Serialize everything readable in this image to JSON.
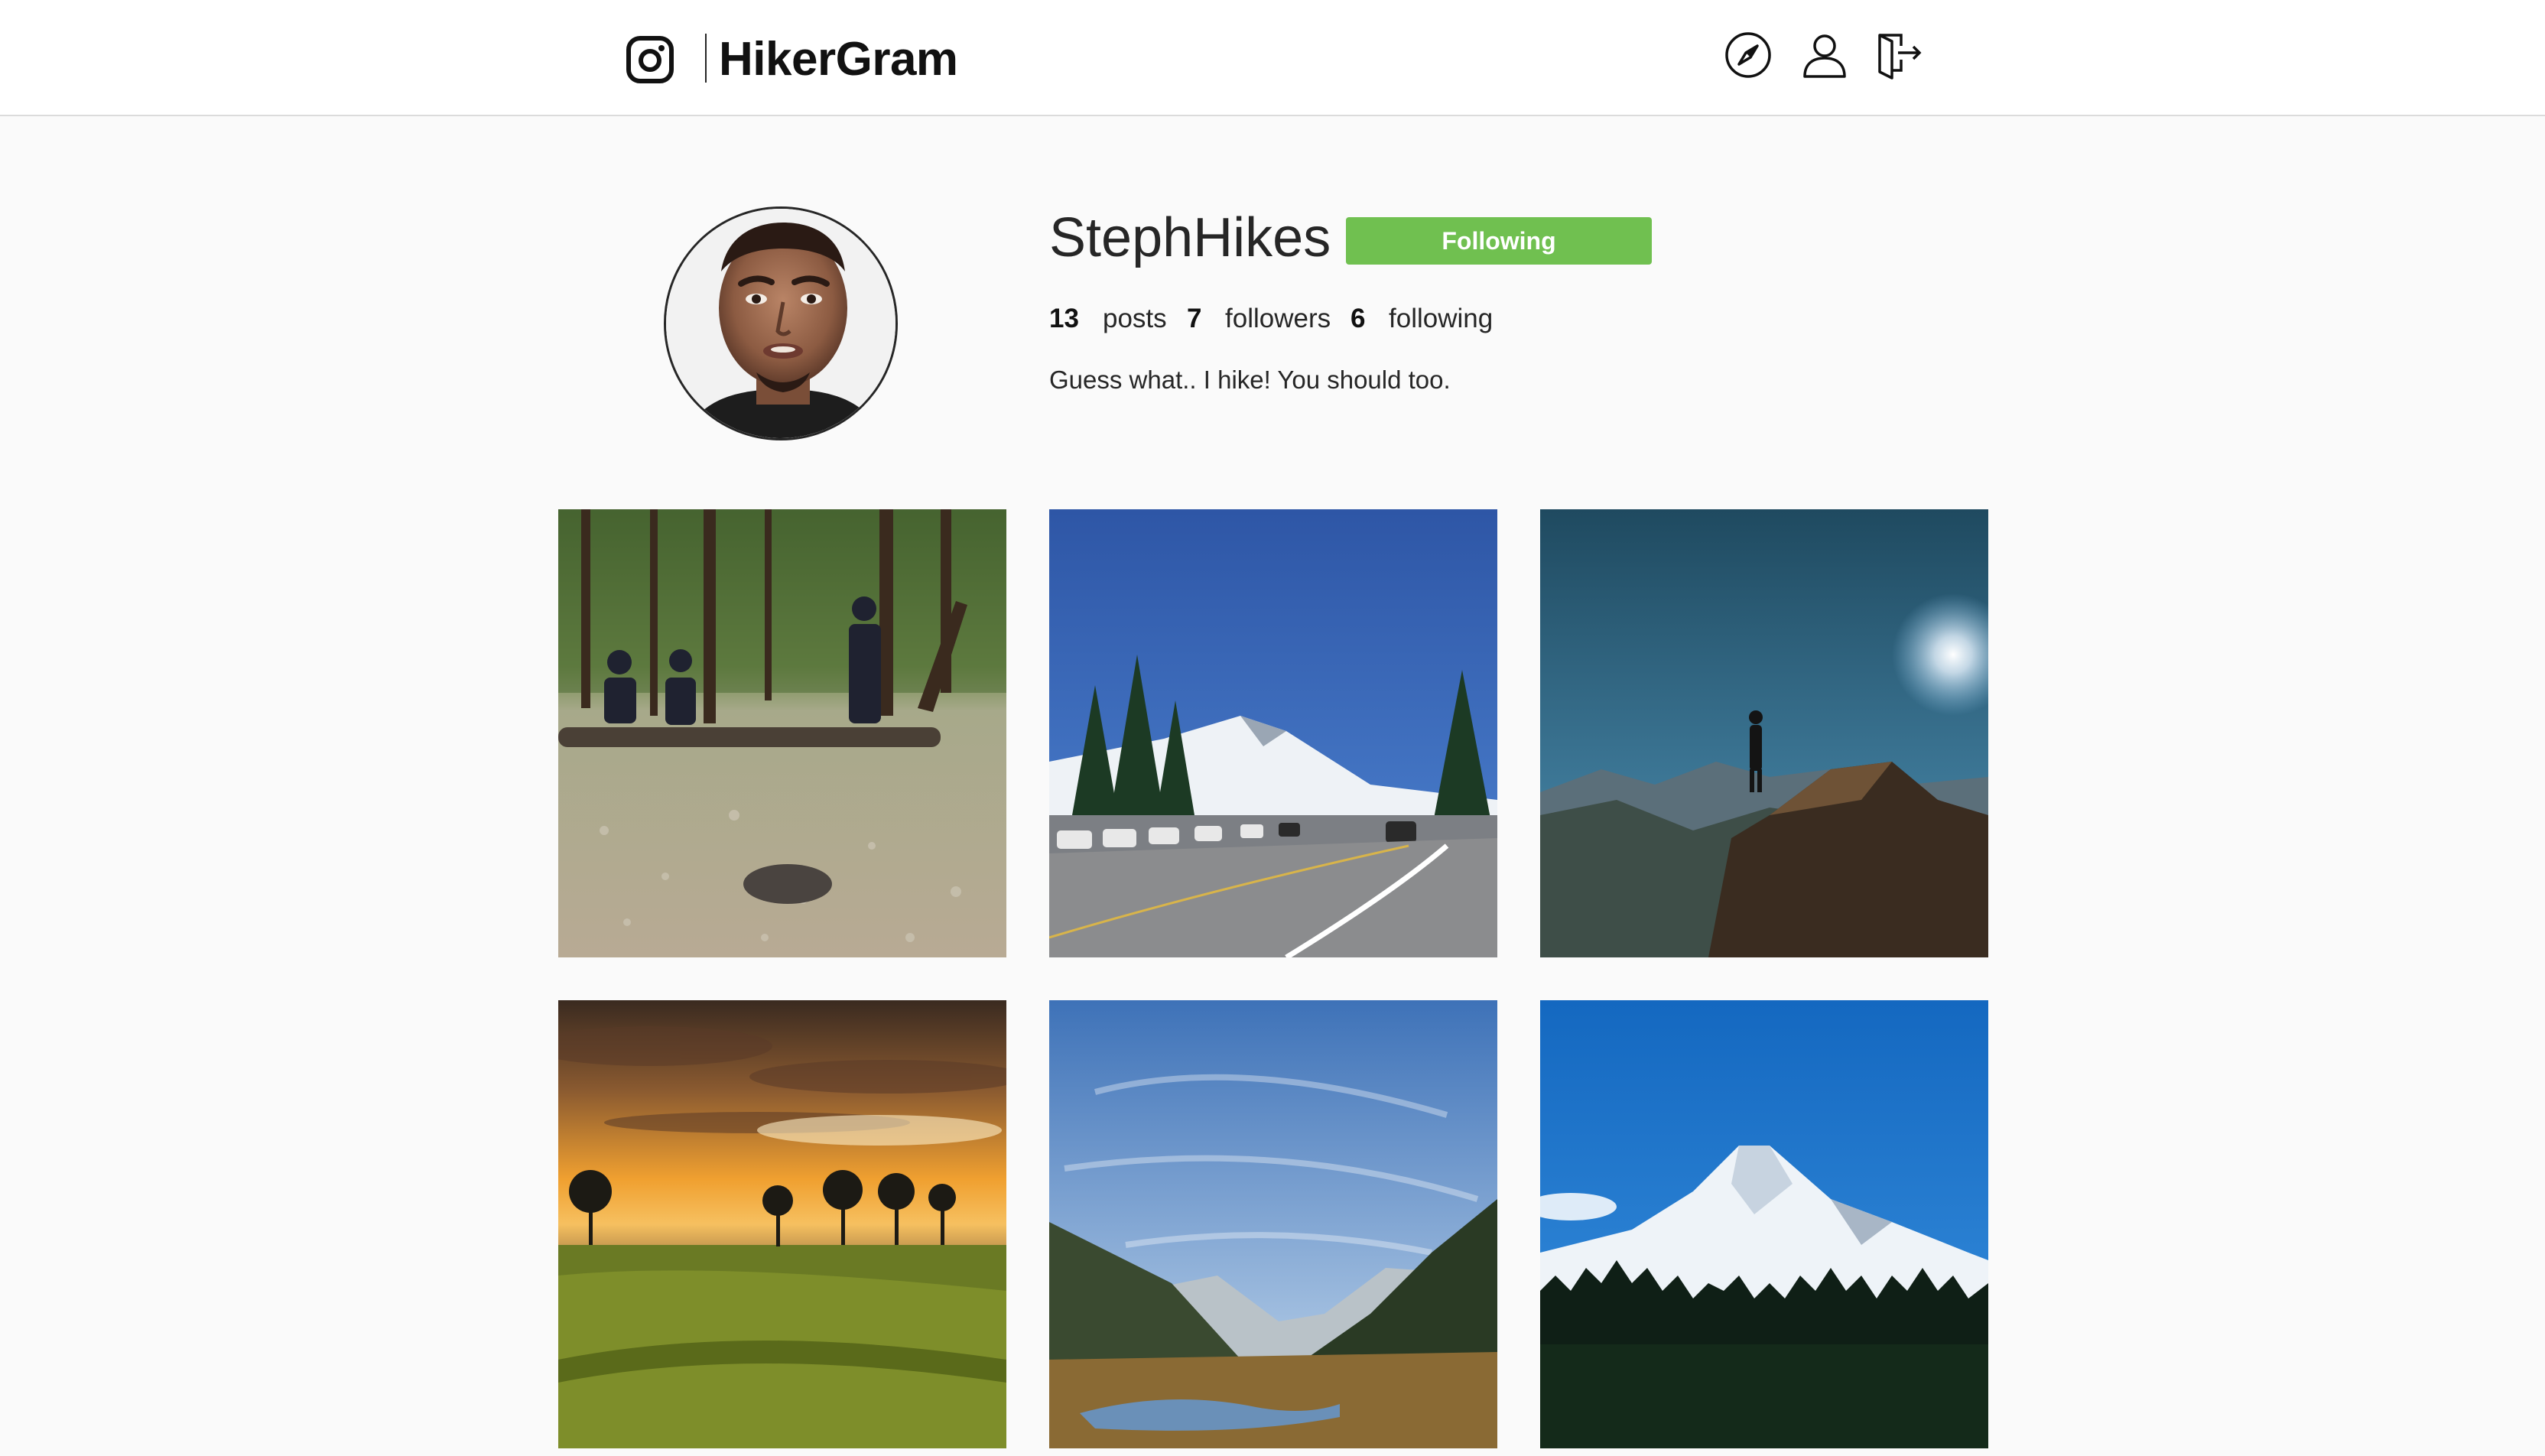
{
  "app": {
    "title": "HikerGram",
    "logo_icon": "camera-icon"
  },
  "nav": [
    {
      "name": "explore",
      "icon": "compass-icon"
    },
    {
      "name": "profile",
      "icon": "user-icon"
    },
    {
      "name": "logout",
      "icon": "logout-icon"
    }
  ],
  "profile": {
    "username": "StephHikes",
    "follow_button_label": "Following",
    "posts_count": "13",
    "posts_label": "posts",
    "followers_count": "7",
    "followers_label": "followers",
    "following_count": "6",
    "following_label": "following",
    "bio": "Guess what.. I hike! You should too."
  },
  "colors": {
    "follow_button": "#70c050",
    "background": "#fafafa",
    "header": "#ffffff"
  },
  "posts": [
    {
      "subject": "campers-in-forest"
    },
    {
      "subject": "mountain-road-parking"
    },
    {
      "subject": "hiker-on-peak"
    },
    {
      "subject": "sunset-meadow"
    },
    {
      "subject": "mountain-valley-stream"
    },
    {
      "subject": "snowy-peak-forest"
    }
  ]
}
